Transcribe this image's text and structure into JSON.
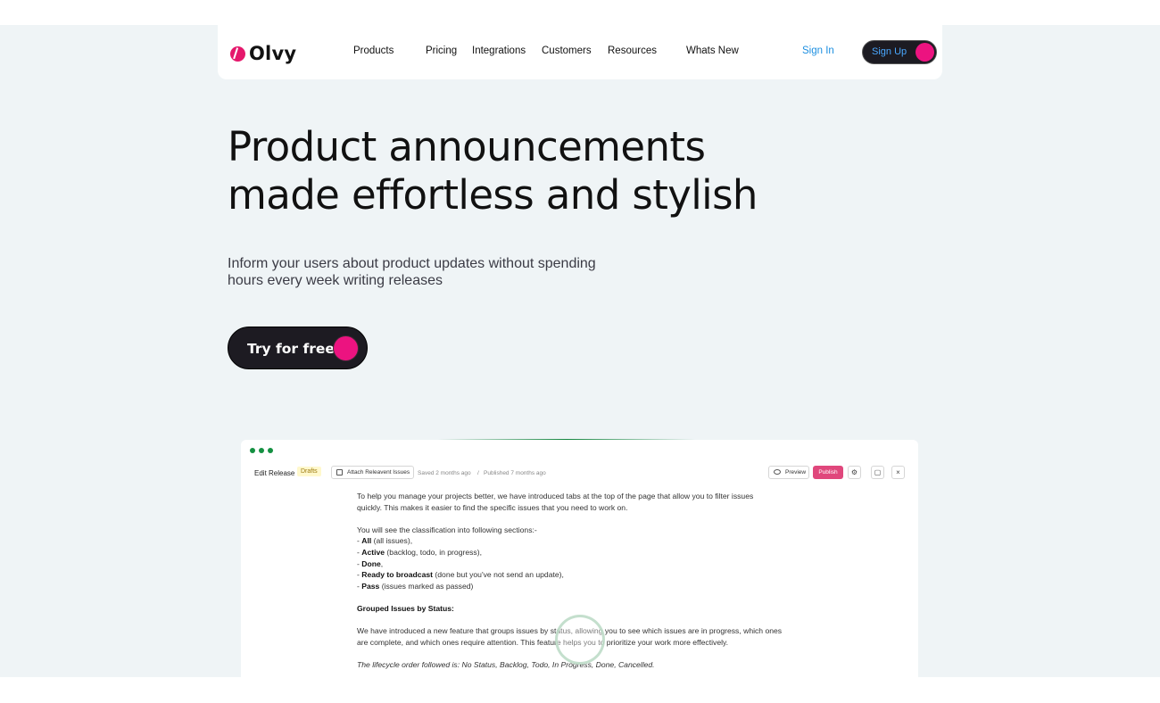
{
  "brand": {
    "name": "Olvy",
    "accent": "#ec1380"
  },
  "nav": {
    "items": [
      "Products",
      "Pricing",
      "Integrations",
      "Customers",
      "Resources",
      "Whats New"
    ],
    "sign_in": "Sign In",
    "sign_up": "Sign Up"
  },
  "hero": {
    "title_line1": "Product announcements",
    "title_line2": "made effortless and stylish",
    "subtitle_line1": "Inform your users about product updates without spending",
    "subtitle_line2": "hours every week writing releases",
    "cta": "Try for free"
  },
  "app": {
    "title": "Edit Release",
    "badge": "Drafts",
    "attach_button": "Attach Releavent Issues",
    "saved": "Saved 2 months ago",
    "separator": "/",
    "published": "Published 7 months ago",
    "preview_button": "Preview",
    "publish_button": "Publish",
    "doc": {
      "p1_line1": "To help you manage your projects better, we have introduced tabs at the top of the page that allow you to filter issues",
      "p1_line2": "quickly. This makes it easier to find the specific issues that you need to work on.",
      "p2": "You will see the classification into following sections:-",
      "items": [
        {
          "bold": "All",
          "rest": " (all issues),"
        },
        {
          "bold": "Active",
          "rest": " (backlog, todo, in progress),"
        },
        {
          "bold": "Done",
          "rest": ","
        },
        {
          "bold": "Ready to broadcast",
          "rest": " (done but you've not send an update),"
        },
        {
          "bold": "Pass",
          "rest": " (issues marked as passed)"
        }
      ],
      "bullet": "- ",
      "heading": "Grouped Issues by Status:",
      "p3_line1": "We have introduced a new feature that groups issues by status, allowing you to see which issues are in progress, which ones",
      "p3_line2": "are complete, and which ones require attention. This feature helps you to prioritize your work more effectively.",
      "p4": "The lifecycle order followed is: No Status, Backlog, Todo, In Progress, Done, Cancelled."
    }
  }
}
